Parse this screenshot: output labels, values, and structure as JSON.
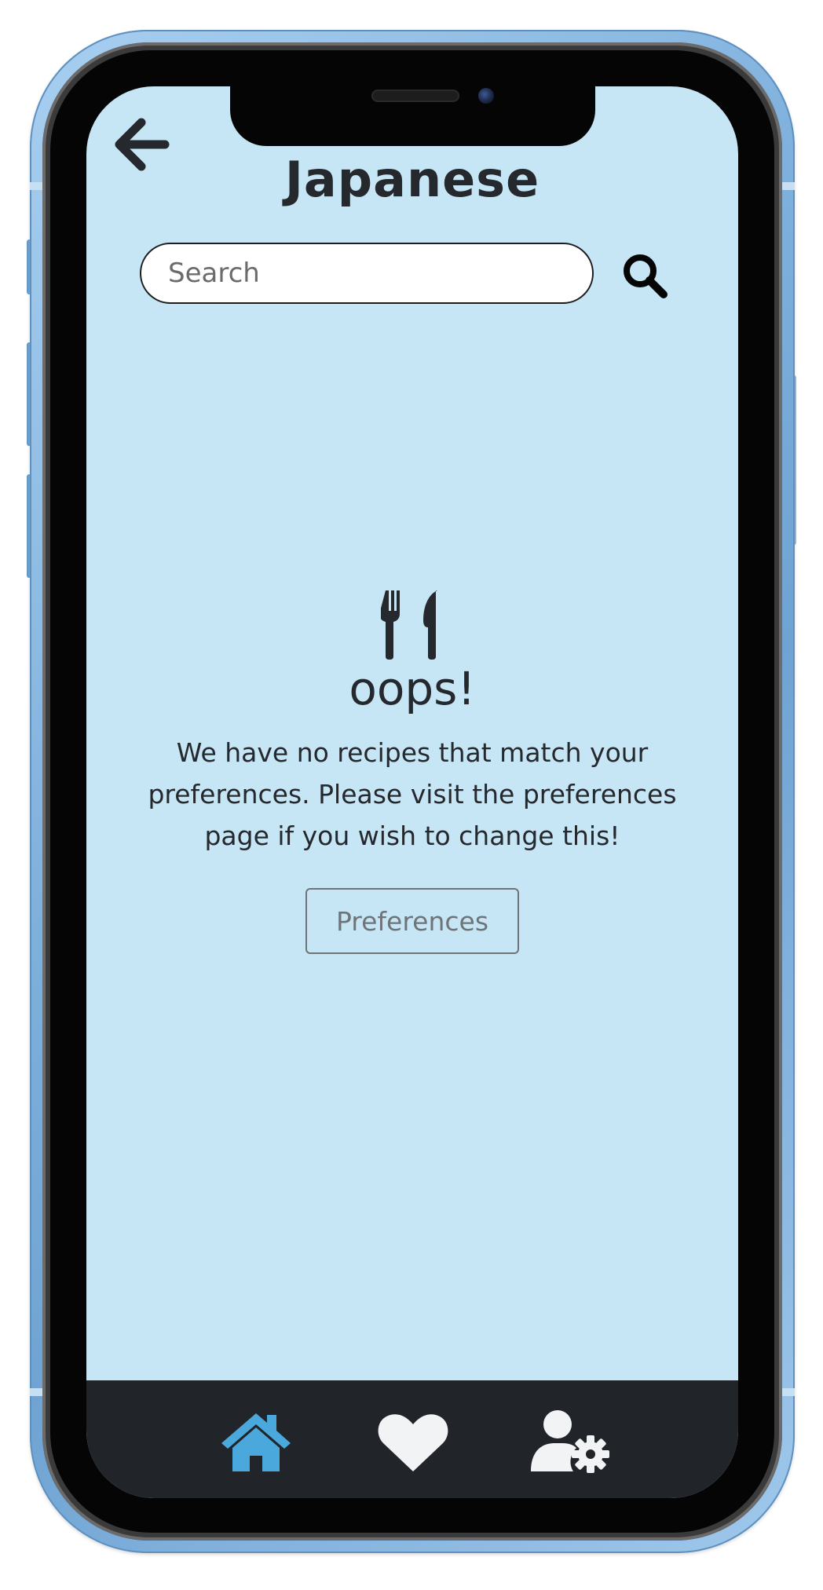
{
  "app": {
    "title": "Japanese"
  },
  "header": {
    "back_icon": "arrow-left-icon"
  },
  "search": {
    "placeholder": "Search",
    "value": "",
    "icon": "search-icon"
  },
  "empty_state": {
    "icon": "utensils-icon",
    "heading": "oops!",
    "message": "We have no recipes that match your preferences. Please visit the preferences page if you wish to change this!",
    "button_label": "Preferences"
  },
  "bottom_nav": {
    "items": [
      {
        "icon": "home-icon",
        "active": true
      },
      {
        "icon": "heart-icon",
        "active": false
      },
      {
        "icon": "user-settings-icon",
        "active": false
      }
    ]
  },
  "colors": {
    "screen_background": "#c6e6f6",
    "text": "#25282c",
    "nav_background": "#212529",
    "nav_active": "#4aa8dc",
    "nav_inactive": "#f1f3f5",
    "phone_frame": "#7eb0dc"
  }
}
